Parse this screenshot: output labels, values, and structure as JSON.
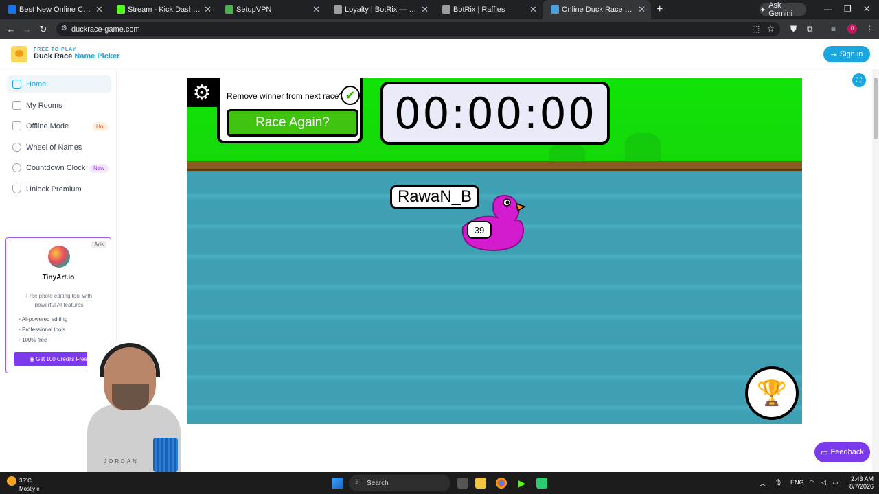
{
  "browser": {
    "tabs": [
      {
        "title": "Best New Online Casino Ga",
        "color": "#1a73e8"
      },
      {
        "title": "Stream - Kick Dashboard",
        "color": "#53fc18"
      },
      {
        "title": "SetupVPN",
        "color": "#4caf50"
      },
      {
        "title": "Loyalty | BotRix — Cloud Stream",
        "color": "#9e9e9e"
      },
      {
        "title": "BotRix | Raffles",
        "color": "#9e9e9e"
      },
      {
        "title": "Online Duck Race Name Pi",
        "color": "#4aa3df"
      }
    ],
    "ask_gemini": "Ask Gemini",
    "url": "duckrace-game.com"
  },
  "header": {
    "brand_small": "FREE TO PLAY",
    "brand_part1": "Duck Race",
    "brand_part2": "Name Picker",
    "signin": "Sign in"
  },
  "sidebar": {
    "items": [
      {
        "label": "Home",
        "badge": ""
      },
      {
        "label": "My Rooms",
        "badge": ""
      },
      {
        "label": "Offline Mode",
        "badge": "Hot"
      },
      {
        "label": "Wheel of Names",
        "badge": ""
      },
      {
        "label": "Countdown Clock",
        "badge": "New"
      },
      {
        "label": "Unlock Premium",
        "badge": ""
      }
    ]
  },
  "ad": {
    "tag": "Ads",
    "title": "TinyArt.io",
    "description": "Free photo editing tool with powerful AI features",
    "features": [
      "AI-powered editing",
      "Professional tools",
      "100% free"
    ],
    "cta": "Get 100 Credits Free"
  },
  "game": {
    "remove_winner": "Remove winner from next race?",
    "race_again": "Race Again?",
    "timer": "00:00:00",
    "duck_name": "RawaN_B",
    "duck_number": "39",
    "duck_color": "#d41ccf"
  },
  "feedback": "Feedback",
  "webcam": {
    "shirt_text": "JORDAN"
  },
  "taskbar": {
    "temperature": "35°C",
    "weather_text": "Mostly c",
    "search": "Search",
    "lang": "ENG",
    "time": "2:43 AM",
    "date": "8/7/2026"
  }
}
